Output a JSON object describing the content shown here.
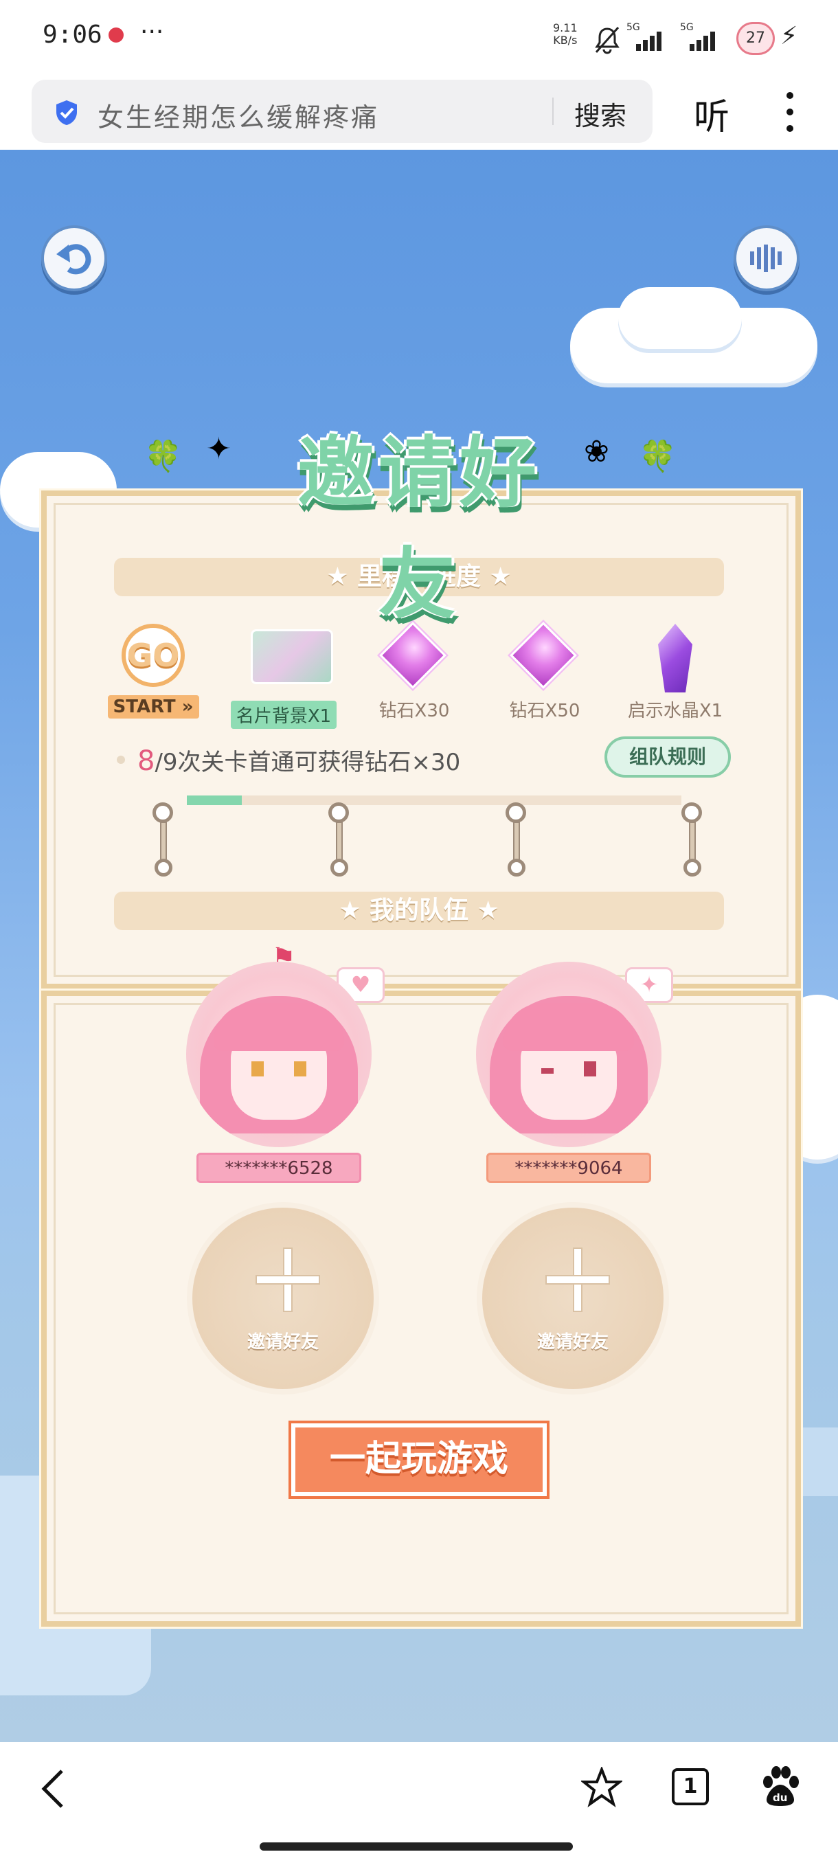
{
  "status_bar": {
    "time": "9:06",
    "more": "···",
    "net_speed": "9.11",
    "net_unit": "KB/s",
    "signal1": "5G",
    "signal2": "5G",
    "battery": "27"
  },
  "browser": {
    "query": "女生经期怎么缓解疼痛",
    "search_label": "搜索",
    "listen_label": "听"
  },
  "game": {
    "title": "邀请好友",
    "milestone_title": "★ 里程碑进度 ★",
    "milestones": [
      {
        "icon": "go-badge",
        "badge": "GO",
        "label": "START »"
      },
      {
        "icon": "card-background-icon",
        "label": "名片背景X1"
      },
      {
        "icon": "diamond-icon",
        "label": "钻石X30"
      },
      {
        "icon": "diamond-icon",
        "label": "钻石X50"
      },
      {
        "icon": "crystal-icon",
        "label": "启示水晶X1"
      }
    ],
    "progress_current": "8",
    "progress_text": "/9次关卡首通可获得钻石×30",
    "rules_button": "组队规则",
    "team_title": "★ 我的队伍 ★",
    "members": [
      {
        "name": "*******6528"
      },
      {
        "name": "*******9064"
      }
    ],
    "invite_label": "邀请好友",
    "play_button": "一起玩游戏"
  },
  "colors": {
    "sky": "#5d97e0",
    "panel": "#fbf4ea",
    "accent_green": "#7fd3a8",
    "play_orange": "#f5895e"
  },
  "navbar": {
    "tabs_count": "1"
  }
}
